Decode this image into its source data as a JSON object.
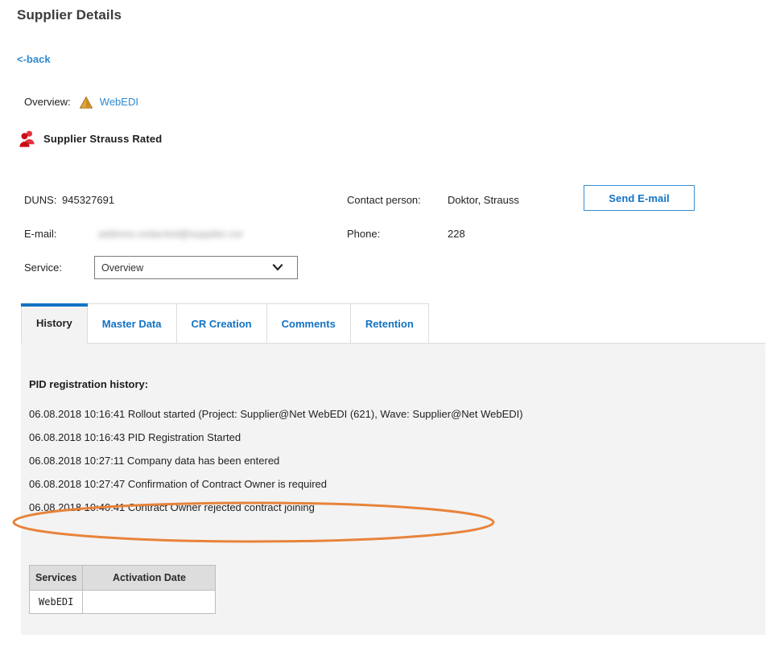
{
  "page": {
    "title": "Supplier Details",
    "back_link": "<-back"
  },
  "overview": {
    "label": "Overview:",
    "icon": "warning-triangle-icon",
    "service_link": "WebEDI"
  },
  "supplier": {
    "icon": "people-group-icon",
    "heading": "Supplier Strauss Rated"
  },
  "details": {
    "duns_label": "DUNS:",
    "duns_value": "945327691",
    "email_label": "E-mail:",
    "email_value_redacted": "address.redacted@supplier.com",
    "contact_label": "Contact person:",
    "contact_value": "Doktor, Strauss",
    "phone_label": "Phone:",
    "phone_value": "228",
    "send_email_label": "Send E-mail"
  },
  "service": {
    "label": "Service:",
    "selected": "Overview",
    "options": [
      "Overview"
    ],
    "arrow_icon": "chevron-down-icon"
  },
  "tabs": [
    {
      "label": "History",
      "active": true
    },
    {
      "label": "Master Data",
      "active": false
    },
    {
      "label": "CR Creation",
      "active": false
    },
    {
      "label": "Comments",
      "active": false
    },
    {
      "label": "Retention",
      "active": false
    }
  ],
  "history": {
    "title": "PID registration history:",
    "entries": [
      "06.08.2018 10:16:41 Rollout started (Project: Supplier@Net WebEDI (621), Wave: Supplier@Net WebEDI)",
      "06.08.2018 10:16:43 PID Registration Started",
      "06.08.2018 10:27:11 Company data has been entered",
      "06.08.2018 10:27:47 Confirmation of Contract Owner is required",
      "06.08.2018 10:40:41 Contract Owner rejected contract joining"
    ]
  },
  "annotation": {
    "shape": "ellipse",
    "color": "#E8833A",
    "highlights_entry_index": 4
  },
  "services_table": {
    "columns": [
      "Services",
      "Activation Date"
    ],
    "rows": [
      {
        "service": "WebEDI",
        "activation_date": ""
      }
    ]
  },
  "colors": {
    "link_blue": "#2e8ad4",
    "tab_blue": "#1273c4",
    "accent_orange": "#E8833A",
    "panel_gray": "#f3f3f3",
    "warning_icon": "#D99A2B",
    "people_icon": "#D9232E"
  }
}
